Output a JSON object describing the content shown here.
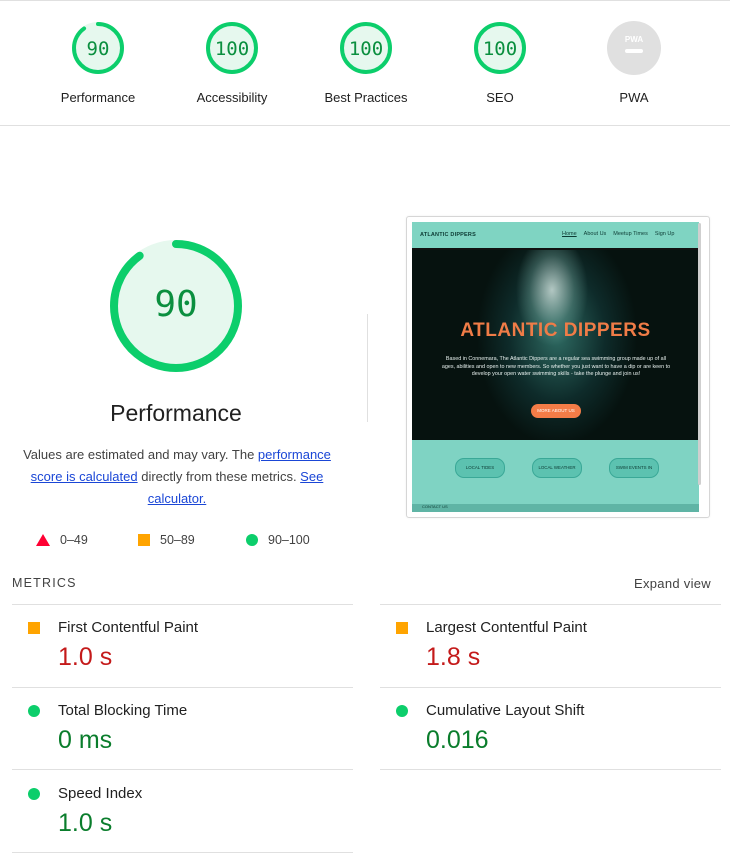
{
  "categories": [
    {
      "label": "Performance",
      "score": "90",
      "fraction": 0.9,
      "status": "pass"
    },
    {
      "label": "Accessibility",
      "score": "100",
      "fraction": 1.0,
      "status": "pass"
    },
    {
      "label": "Best Practices",
      "score": "100",
      "fraction": 1.0,
      "status": "pass"
    },
    {
      "label": "SEO",
      "score": "100",
      "fraction": 1.0,
      "status": "pass"
    },
    {
      "label": "PWA",
      "score": "PWA",
      "fraction": 0,
      "status": "na"
    }
  ],
  "main": {
    "score": "90",
    "fraction": 0.9,
    "title": "Performance",
    "desc_prefix": "Values are estimated and may vary. The ",
    "desc_link1": "performance score is calculated",
    "desc_middle": " directly from these metrics. ",
    "desc_link2": "See calculator."
  },
  "legend": [
    {
      "range": "0–49",
      "shape": "triangle"
    },
    {
      "range": "50–89",
      "shape": "square"
    },
    {
      "range": "90–100",
      "shape": "circle"
    }
  ],
  "thumbnail": {
    "brand": "ATLANTIC DIPPERS",
    "nav": [
      "Home",
      "About Us",
      "Meetup Times",
      "Sign Up"
    ],
    "hero_title": "ATLANTIC DIPPERS",
    "hero_text": "Based in Connemara, The Atlantic Dippers are a regular sea swimming group made up of all ages, abilities and open to new members. So whether you just want to have a dip or are keen to develop your open water swimming skills - take the plunge and join us!",
    "hero_button": "MORE ABOUT US",
    "pills": [
      "LOCAL TIDES",
      "LOCAL WEATHER",
      "SWIM EVENTS IN"
    ],
    "footer": "CONTACT US"
  },
  "metrics_header": "METRICS",
  "expand_label": "Expand view",
  "metrics": [
    {
      "name": "First Contentful Paint",
      "value": "1.0 s",
      "status": "average"
    },
    {
      "name": "Largest Contentful Paint",
      "value": "1.8 s",
      "status": "average"
    },
    {
      "name": "Total Blocking Time",
      "value": "0 ms",
      "status": "pass"
    },
    {
      "name": "Cumulative Layout Shift",
      "value": "0.016",
      "status": "pass"
    },
    {
      "name": "Speed Index",
      "value": "1.0 s",
      "status": "pass"
    }
  ],
  "colors": {
    "pass": "#0cce6b",
    "pass_text": "#0b8f3f",
    "pass_fill": "#e6f8ee",
    "average": "#ffa400",
    "fail": "#ff0033",
    "na": "#9e9e9e"
  }
}
